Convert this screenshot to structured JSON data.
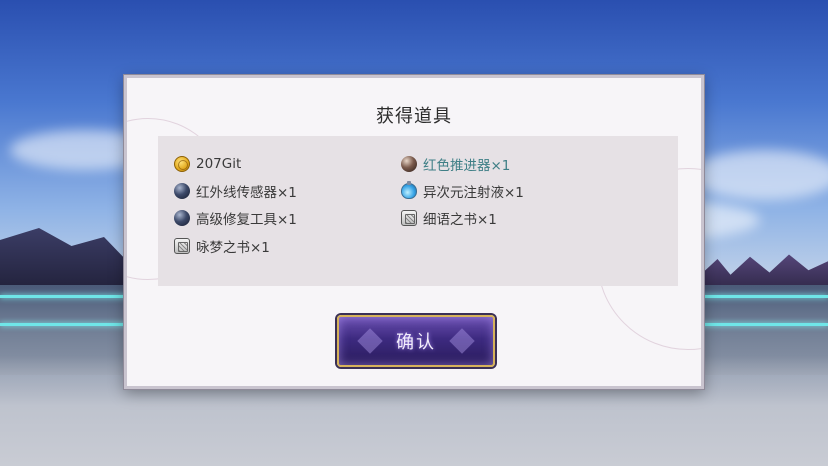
{
  "dialog": {
    "title": "获得道具",
    "confirm_label": "确认"
  },
  "items": [
    {
      "label": "207Git",
      "icon": "gold-coin-icon",
      "highlight": false
    },
    {
      "label": "红色推进器×1",
      "icon": "red-sphere-icon",
      "highlight": true
    },
    {
      "label": "红外线传感器×1",
      "icon": "dark-sphere-icon",
      "highlight": false
    },
    {
      "label": "异次元注射液×1",
      "icon": "blue-potion-icon",
      "highlight": false
    },
    {
      "label": "高级修复工具×1",
      "icon": "dark-sphere-icon",
      "highlight": false
    },
    {
      "label": "细语之书×1",
      "icon": "book-icon",
      "highlight": false
    },
    {
      "label": "咏梦之书×1",
      "icon": "book-icon",
      "highlight": false
    }
  ],
  "colors": {
    "highlight_text": "#3f7f86",
    "button_border": "#d6b25a",
    "button_fill": "#3d2a80"
  }
}
